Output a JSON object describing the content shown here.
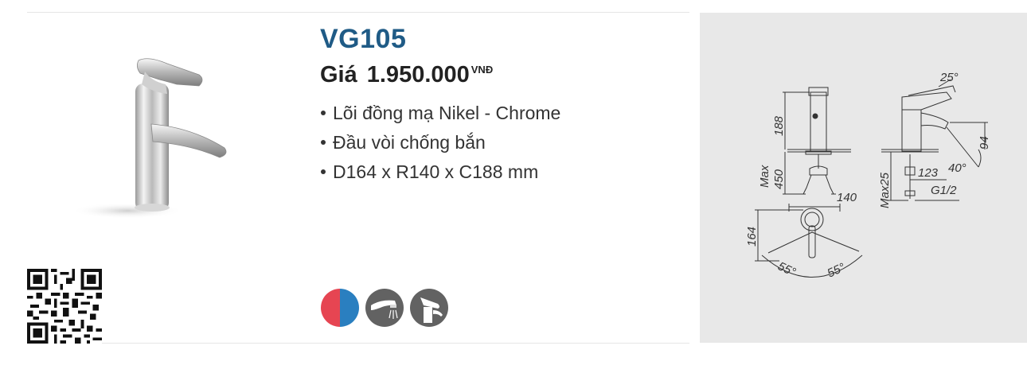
{
  "product": {
    "model": "VG105",
    "price_prefix": "Giá",
    "price_value": "1.950.000",
    "price_currency": "VNĐ",
    "features": [
      "Lõi đồng mạ Nikel - Chrome",
      "Đầu vòi chống bắn",
      "D164 x R140 x C188 mm"
    ]
  },
  "feature_icons": [
    "hot-cold-icon",
    "aerator-spray-icon",
    "faucet-handle-icon"
  ],
  "drawing": {
    "labels": {
      "h188": "188",
      "max450_a": "Max",
      "max450_b": "450",
      "angle25": "25°",
      "h94": "94",
      "max25": "Max25",
      "d123": "123",
      "angle40": "40°",
      "g12": "G1/2",
      "w140": "140",
      "d164": "164",
      "angle55l": "55°",
      "angle55r": "55°"
    }
  },
  "colors": {
    "title_blue": "#1f5b86",
    "hot_red": "#e64552",
    "cold_blue": "#2a7fc0",
    "panel_bg": "#e8e8e8"
  }
}
